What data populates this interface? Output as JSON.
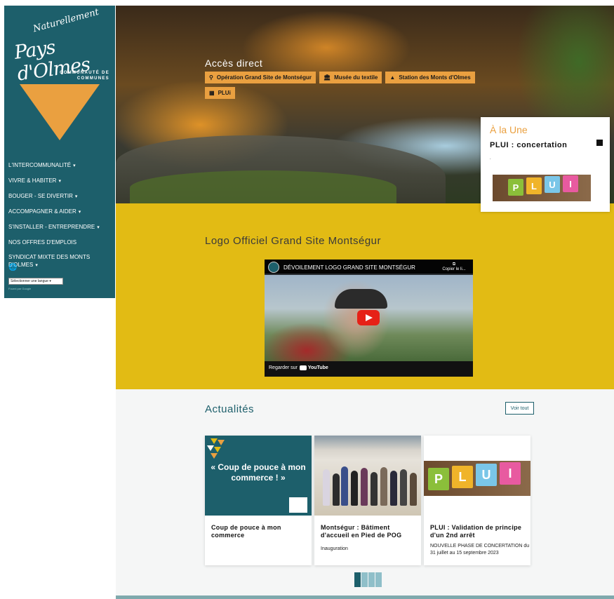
{
  "logo": {
    "tagline": "Naturellement",
    "name": "Pays d'Olmes",
    "sub1": "COMMUNAUTÉ DE",
    "sub2": "COMMUNES",
    "triangle_color": "#eaa040"
  },
  "sidebar": {
    "background": "#1d5f6b",
    "items": [
      {
        "label": "L'INTERCOMMUNALITÉ",
        "has_caret": true
      },
      {
        "label": "VIVRE & HABITER",
        "has_caret": true
      },
      {
        "label": "BOUGER - SE DIVERTIR",
        "has_caret": true
      },
      {
        "label": "ACCOMPAGNER & AIDER",
        "has_caret": true
      },
      {
        "label": "S'INSTALLER - ENTREPRENDRE",
        "has_caret": true
      },
      {
        "label": "NOS OFFRES D'EMPLOIS",
        "has_caret": false
      },
      {
        "label": "SYNDICAT MIXTE DES MONTS D'OLMES",
        "has_caret": true
      }
    ],
    "caret": "▾",
    "globe_icon": "globe-icon",
    "language_select": "Sélectionner une langue",
    "powered_by": "Fourni par Google"
  },
  "hero": {
    "acces_title": "Accès direct",
    "buttons": [
      {
        "label": "Opération Grand Site de Montségur",
        "icon": "person-pin-icon"
      },
      {
        "label": "Musée du textile",
        "icon": "museum-icon"
      },
      {
        "label": "Station des Monts d'Olmes",
        "icon": "mountain-icon"
      },
      {
        "label": "PLUi",
        "icon": "building-icon"
      }
    ],
    "accent": "#eaa040"
  },
  "une": {
    "title": "À la Une",
    "headline": "PLUI : concertation",
    "dot": "."
  },
  "video_section": {
    "title": "Logo Officiel Grand Site Montségur",
    "video_title": "DÉVOILEMENT LOGO GRAND SITE MONTSÉGUR",
    "copy_label": "Copier le li...",
    "watch_label": "Regarder sur",
    "youtube": "YouTube",
    "background": "#e2bb14"
  },
  "news": {
    "title": "Actualités",
    "see_all": "Voir tout",
    "cards": [
      {
        "title": "Coup de pouce à mon commerce",
        "text": "",
        "image_quote": "« Coup de pouce à mon commerce ! »"
      },
      {
        "title": "Montségur : Bâtiment d'accueil en Pied de POG",
        "text": "Inauguration"
      },
      {
        "title": "PLUI : Validation de principe d'un 2nd arrêt",
        "text": "NOUVELLE PHASE DE CONCERTATION du 31 juillet au 15 septembre 2023"
      }
    ],
    "pager_count": 4,
    "pager_active": 0
  },
  "tiles": [
    "P",
    "L",
    "U",
    "I"
  ]
}
